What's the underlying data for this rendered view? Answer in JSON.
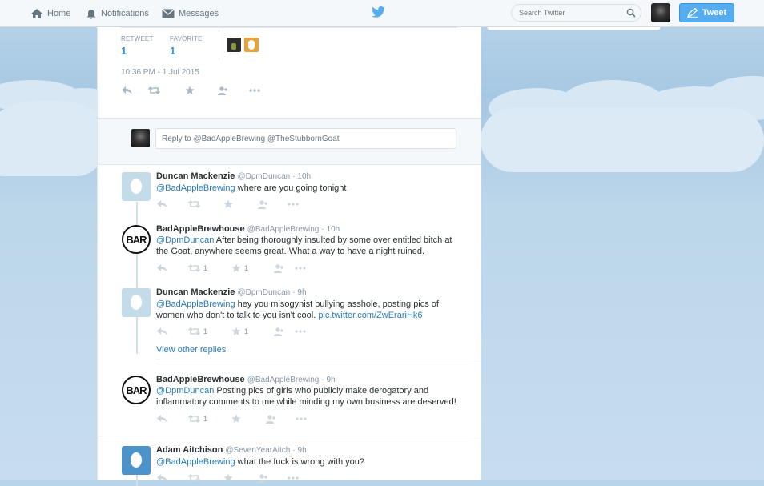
{
  "nav": {
    "home_label": "Home",
    "notifications_label": "Notifications",
    "messages_label": "Messages",
    "search_placeholder": "Search Twitter",
    "tweet_button_label": "Tweet"
  },
  "main_tweet": {
    "retweet_label": "RETWEET",
    "retweet_count": "1",
    "favorite_label": "FAVORITE",
    "favorite_count": "1",
    "timestamp": "10:36 PM - 1 Jul 2015"
  },
  "reply_box": {
    "placeholder": "Reply to @BadAppleBrewing @TheStubbornGoat"
  },
  "tweets": [
    {
      "name": "Duncan Mackenzie",
      "handle": "@DpmDuncan",
      "time": "· 10h",
      "mention": "@BadAppleBrewing",
      "text": " where are you going tonight",
      "retweets": "",
      "favorites": ""
    },
    {
      "name": "BadAppleBrewhouse",
      "handle": "@BadAppleBrewing",
      "time": "· 10h",
      "mention": "@DpmDuncan",
      "text": " After being thoroughly insulted by some over entitled bitch at the Goat, anywhere seems great. What a way to have a night ruined.",
      "retweets": "1",
      "favorites": "1"
    },
    {
      "name": "Duncan Mackenzie",
      "handle": "@DpmDuncan",
      "time": "· 9h",
      "mention": "@BadAppleBrewing",
      "text": "  hey you misogynist  bullying asshole, posting pics of women who don't to talk to you isn't cool. ",
      "link": "pic.twitter.com/ZwErariHk6",
      "retweets": "1",
      "favorites": "1"
    },
    {
      "name": "BadAppleBrewhouse",
      "handle": "@BadAppleBrewing",
      "time": "· 9h",
      "mention": "@DpmDuncan",
      "text": " Posting pics of girls who publicly make derogatory and inflammatory comments to me while minding my own business are deserved!",
      "retweets": "1",
      "favorites": ""
    },
    {
      "name": "Adam Aitchison",
      "handle": "@SevenYearAitch",
      "time": "· 9h",
      "mention": "@BadAppleBrewing",
      "text": " what the fuck is wrong with you?",
      "retweets": "",
      "favorites": ""
    }
  ],
  "view_other_replies": "View other replies",
  "colors": {
    "twitter_blue": "#55acee",
    "link_blue": "#2b7bb9",
    "muted_gray": "#8899a6",
    "sky": "#a7c8e3"
  }
}
